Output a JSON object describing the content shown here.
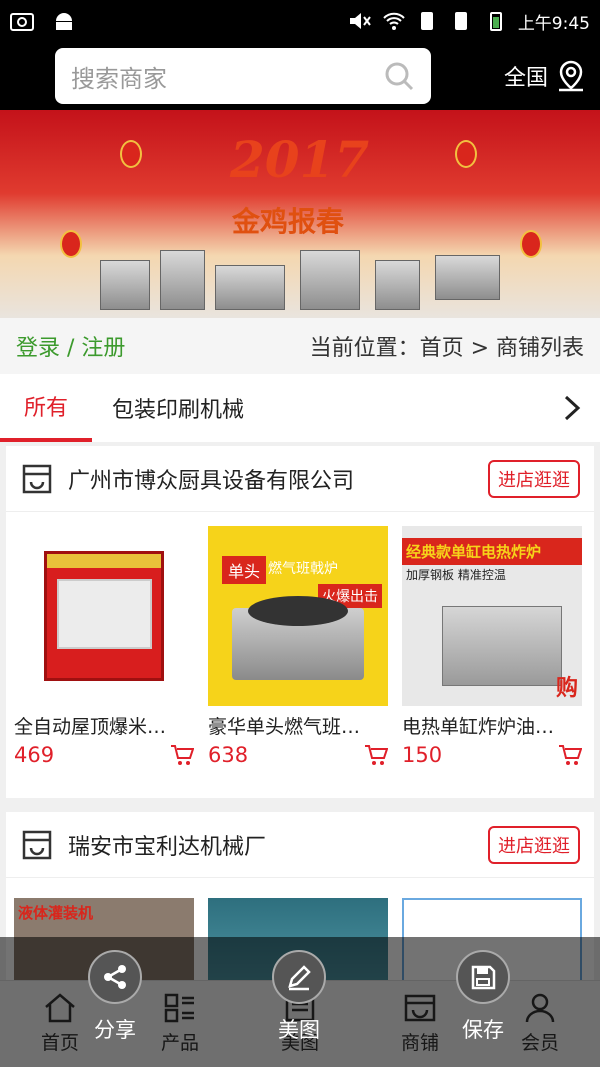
{
  "status": {
    "time": "上午9:45"
  },
  "search": {
    "placeholder": "搜索商家",
    "region": "全国"
  },
  "banner": {
    "title": "2017",
    "subtitle": "金鸡报春"
  },
  "crumb": {
    "login": "登录 / 注册",
    "position": "当前位置：首页 > 商铺列表"
  },
  "tabs": [
    {
      "label": "所有"
    },
    {
      "label": "包装印刷机械"
    }
  ],
  "shops": [
    {
      "name": "广州市博众厨具设备有限公司",
      "enter_label": "进店逛逛",
      "products": [
        {
          "name": "全自动屋顶爆米…",
          "price": "469"
        },
        {
          "name": "豪华单头燃气班…",
          "price": "638"
        },
        {
          "name": "电热单缸炸炉油…",
          "price": "150"
        }
      ]
    },
    {
      "name": "瑞安市宝利达机械厂",
      "enter_label": "进店逛逛",
      "products": [
        {
          "name": "",
          "price": ""
        },
        {
          "name": "",
          "price": ""
        },
        {
          "name": "",
          "price": ""
        }
      ]
    }
  ],
  "product_labels": {
    "p2_top": "单头",
    "p2_sub": "燃气班戟炉",
    "p2_tag": "火爆出击",
    "p3_title": "经典款单缸电热炸炉",
    "p3_sub": "加厚钢板 精准控温",
    "p3_buy": "购",
    "p4_title": "液体灌装机"
  },
  "bottomnav": [
    {
      "label": "首页"
    },
    {
      "label": "产品"
    },
    {
      "label": "美图"
    },
    {
      "label": "商铺"
    },
    {
      "label": "会员"
    }
  ],
  "overlay": [
    {
      "label": "分享"
    },
    {
      "label": "美图"
    },
    {
      "label": "保存"
    }
  ],
  "colors": {
    "accent": "#e0202a",
    "login": "#3c9a2d"
  }
}
